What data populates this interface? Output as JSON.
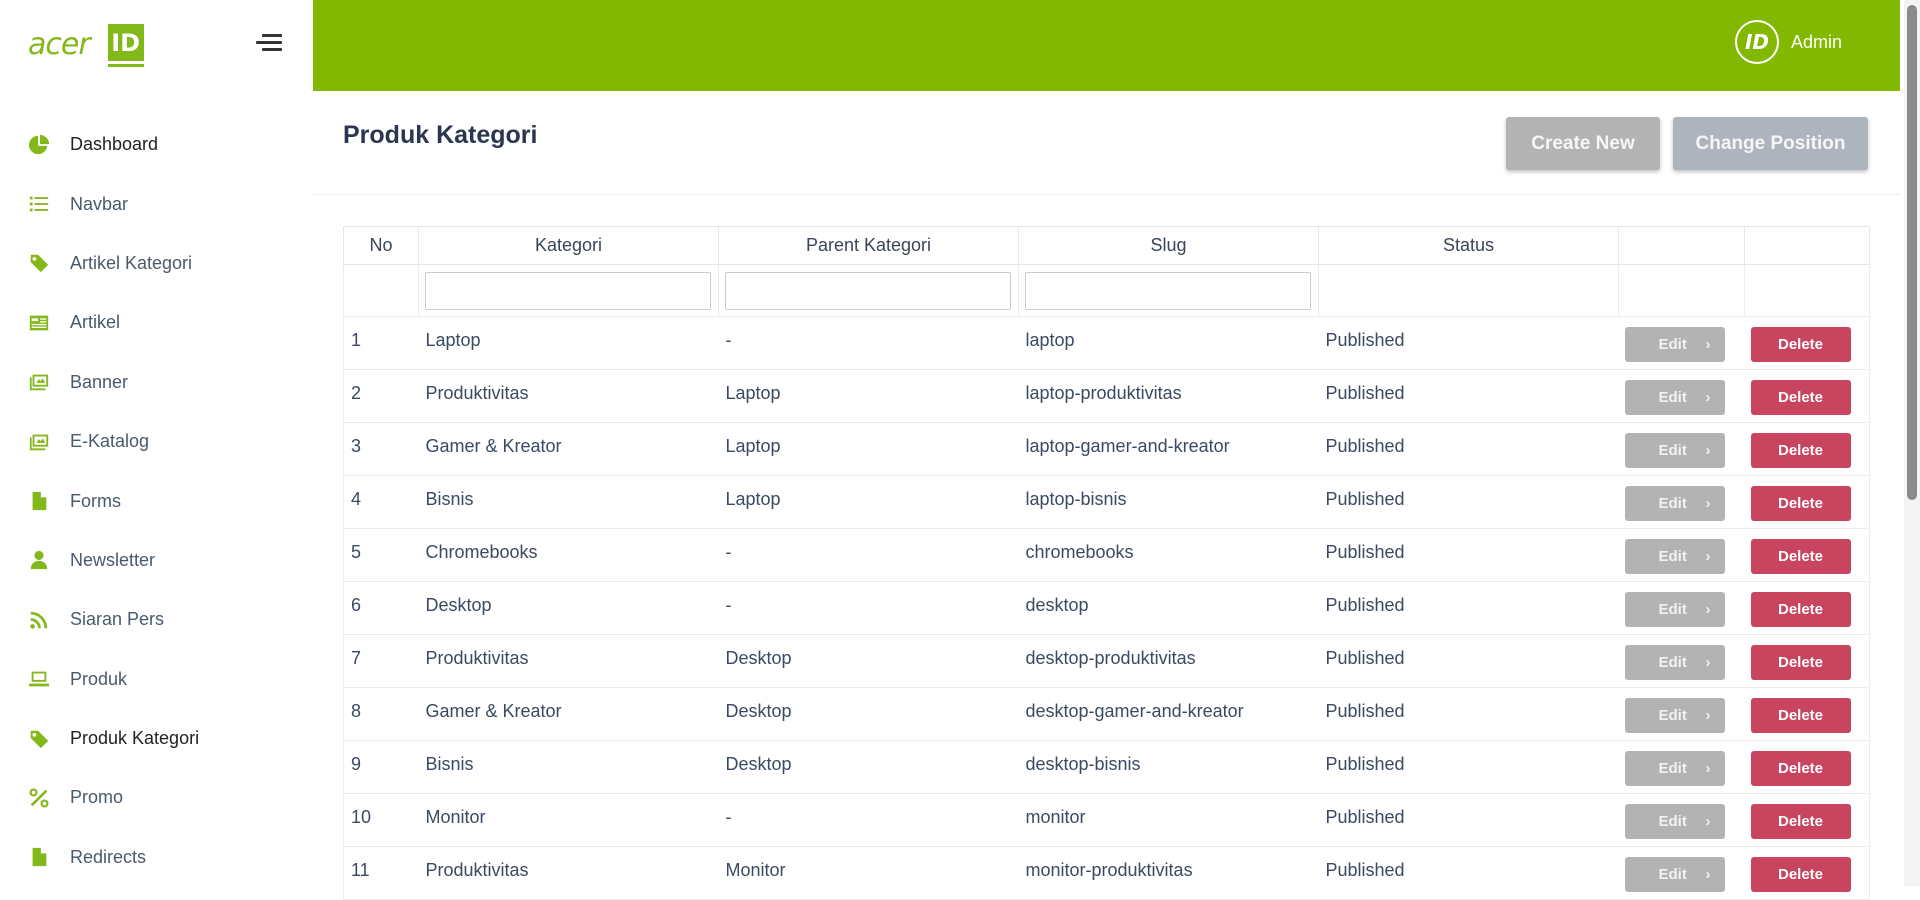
{
  "brand": {
    "logo_text": "acer",
    "logo_badge": "ID"
  },
  "sidebar": {
    "items": [
      {
        "label": "Dashboard",
        "icon": "pie-chart-icon"
      },
      {
        "label": "Navbar",
        "icon": "list-icon"
      },
      {
        "label": "Artikel Kategori",
        "icon": "tag-icon"
      },
      {
        "label": "Artikel",
        "icon": "newspaper-icon"
      },
      {
        "label": "Banner",
        "icon": "images-icon"
      },
      {
        "label": "E-Katalog",
        "icon": "images-icon"
      },
      {
        "label": "Forms",
        "icon": "file-icon"
      },
      {
        "label": "Newsletter",
        "icon": "user-icon"
      },
      {
        "label": "Siaran Pers",
        "icon": "rss-icon"
      },
      {
        "label": "Produk",
        "icon": "laptop-icon"
      },
      {
        "label": "Produk Kategori",
        "icon": "tag-icon"
      },
      {
        "label": "Promo",
        "icon": "percent-icon"
      },
      {
        "label": "Redirects",
        "icon": "file-icon"
      }
    ]
  },
  "topbar": {
    "user_name": "Admin",
    "avatar_text": "ID"
  },
  "page": {
    "title": "Produk Kategori",
    "create_label": "Create New",
    "position_label": "Change Position"
  },
  "table": {
    "headers": [
      "No",
      "Kategori",
      "Parent Kategori",
      "Slug",
      "Status",
      "",
      ""
    ],
    "edit_label": "Edit",
    "delete_label": "Delete",
    "rows": [
      {
        "no": "1",
        "kategori": "Laptop",
        "parent": "-",
        "slug": "laptop",
        "status": "Published"
      },
      {
        "no": "2",
        "kategori": "Produktivitas",
        "parent": "Laptop",
        "slug": "laptop-produktivitas",
        "status": "Published"
      },
      {
        "no": "3",
        "kategori": "Gamer & Kreator",
        "parent": "Laptop",
        "slug": "laptop-gamer-and-kreator",
        "status": "Published"
      },
      {
        "no": "4",
        "kategori": "Bisnis",
        "parent": "Laptop",
        "slug": "laptop-bisnis",
        "status": "Published"
      },
      {
        "no": "5",
        "kategori": "Chromebooks",
        "parent": "-",
        "slug": "chromebooks",
        "status": "Published"
      },
      {
        "no": "6",
        "kategori": "Desktop",
        "parent": "-",
        "slug": "desktop",
        "status": "Published"
      },
      {
        "no": "7",
        "kategori": "Produktivitas",
        "parent": "Desktop",
        "slug": "desktop-produktivitas",
        "status": "Published"
      },
      {
        "no": "8",
        "kategori": "Gamer & Kreator",
        "parent": "Desktop",
        "slug": "desktop-gamer-and-kreator",
        "status": "Published"
      },
      {
        "no": "9",
        "kategori": "Bisnis",
        "parent": "Desktop",
        "slug": "desktop-bisnis",
        "status": "Published"
      },
      {
        "no": "10",
        "kategori": "Monitor",
        "parent": "-",
        "slug": "monitor",
        "status": "Published"
      },
      {
        "no": "11",
        "kategori": "Produktivitas",
        "parent": "Monitor",
        "slug": "monitor-produktivitas",
        "status": "Published"
      }
    ]
  },
  "colors": {
    "brand_green": "#83b800",
    "delete_red": "#c9445e",
    "button_gray": "#b3b3b3"
  }
}
